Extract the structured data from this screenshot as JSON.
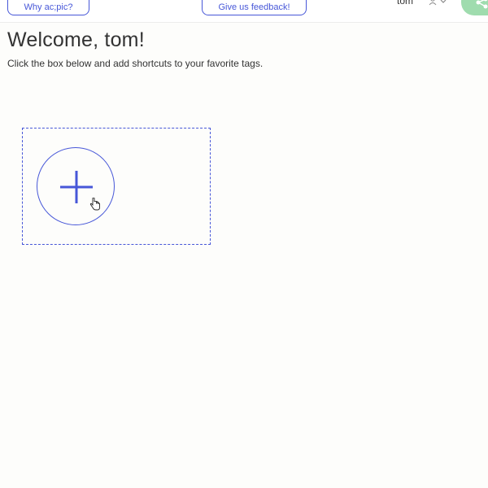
{
  "header": {
    "why_button_label": "Why ac;pic?",
    "feedback_button_label": "Give us feedback!",
    "username": "tom",
    "user_menu_icon": "user-chevron-down-icon",
    "share_icon": "share-icon"
  },
  "main": {
    "welcome_title": "Welcome, tom!",
    "instructions": "Click the box below and add shortcuts to your favorite tags.",
    "add_shortcut_icon": "plus-icon"
  },
  "colors": {
    "accent": "#4757d8",
    "share_button_bg": "#9fdcae",
    "background": "#fdfdfb",
    "text": "#333333"
  }
}
